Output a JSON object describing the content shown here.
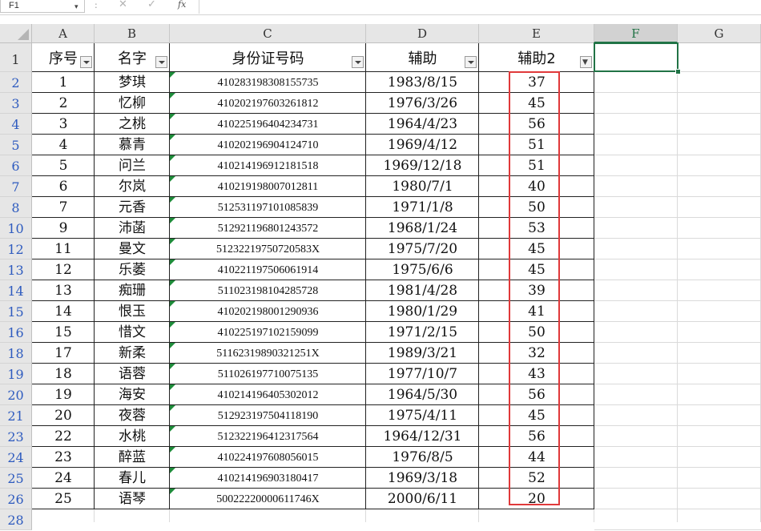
{
  "formula_bar": {
    "name_box": "F1",
    "name_box_arrow": "▾",
    "separator": ":",
    "cancel_icon": "✕",
    "enter_icon": "✓",
    "fx_label": "fx",
    "formula": ""
  },
  "columns": [
    "A",
    "B",
    "C",
    "D",
    "E",
    "F",
    "G"
  ],
  "selected_column": "F",
  "selected_cell": "F1",
  "header_row_number": "1",
  "headers": {
    "A": "序号",
    "B": "名字",
    "C": "身份证号码",
    "D": "辅助",
    "E": "辅助2"
  },
  "filtered_column": "E",
  "row_numbers": [
    "2",
    "3",
    "4",
    "5",
    "6",
    "7",
    "8",
    "10",
    "12",
    "13",
    "14",
    "15",
    "16",
    "18",
    "19",
    "20",
    "21",
    "23",
    "24",
    "25",
    "26",
    "28"
  ],
  "rows": [
    {
      "seq": "1",
      "name": "梦琪",
      "id": "410283198308155735",
      "date": "1983/8/15",
      "age": "37"
    },
    {
      "seq": "2",
      "name": "忆柳",
      "id": "410202197603261812",
      "date": "1976/3/26",
      "age": "45"
    },
    {
      "seq": "3",
      "name": "之桃",
      "id": "410225196404234731",
      "date": "1964/4/23",
      "age": "56"
    },
    {
      "seq": "4",
      "name": "慕青",
      "id": "410202196904124710",
      "date": "1969/4/12",
      "age": "51"
    },
    {
      "seq": "5",
      "name": "问兰",
      "id": "410214196912181518",
      "date": "1969/12/18",
      "age": "51"
    },
    {
      "seq": "6",
      "name": "尔岚",
      "id": "410219198007012811",
      "date": "1980/7/1",
      "age": "40"
    },
    {
      "seq": "7",
      "name": "元香",
      "id": "512531197101085839",
      "date": "1971/1/8",
      "age": "50"
    },
    {
      "seq": "9",
      "name": "沛菡",
      "id": "512921196801243572",
      "date": "1968/1/24",
      "age": "53"
    },
    {
      "seq": "11",
      "name": "曼文",
      "id": "51232219750720583X",
      "date": "1975/7/20",
      "age": "45"
    },
    {
      "seq": "12",
      "name": "乐萎",
      "id": "410221197506061914",
      "date": "1975/6/6",
      "age": "45"
    },
    {
      "seq": "13",
      "name": "痴珊",
      "id": "511023198104285728",
      "date": "1981/4/28",
      "age": "39"
    },
    {
      "seq": "14",
      "name": "恨玉",
      "id": "410202198001290936",
      "date": "1980/1/29",
      "age": "41"
    },
    {
      "seq": "15",
      "name": "惜文",
      "id": "410225197102159099",
      "date": "1971/2/15",
      "age": "50"
    },
    {
      "seq": "17",
      "name": "新柔",
      "id": "51162319890321251X",
      "date": "1989/3/21",
      "age": "32"
    },
    {
      "seq": "18",
      "name": "语蓉",
      "id": "511026197710075135",
      "date": "1977/10/7",
      "age": "43"
    },
    {
      "seq": "19",
      "name": "海安",
      "id": "410214196405302012",
      "date": "1964/5/30",
      "age": "56"
    },
    {
      "seq": "20",
      "name": "夜蓉",
      "id": "512923197504118190",
      "date": "1975/4/11",
      "age": "45"
    },
    {
      "seq": "22",
      "name": "水桃",
      "id": "512322196412317564",
      "date": "1964/12/31",
      "age": "56"
    },
    {
      "seq": "23",
      "name": "醉蓝",
      "id": "410224197608056015",
      "date": "1976/8/5",
      "age": "44"
    },
    {
      "seq": "24",
      "name": "春儿",
      "id": "410214196903180417",
      "date": "1969/3/18",
      "age": "52"
    },
    {
      "seq": "25",
      "name": "语琴",
      "id": "50022220000611746X",
      "date": "2000/6/11",
      "age": "20"
    }
  ],
  "colors": {
    "selection": "#217346",
    "highlight_box": "#e0393a",
    "row_number_text": "#2e5bbf",
    "text_warning_triangle": "#1e8c3a"
  }
}
